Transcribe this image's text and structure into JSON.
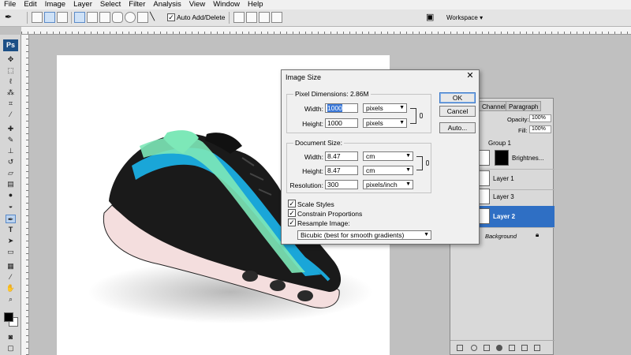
{
  "menu": [
    "File",
    "Edit",
    "Image",
    "Layer",
    "Select",
    "Filter",
    "Analysis",
    "View",
    "Window",
    "Help"
  ],
  "options_bar": {
    "auto_add_delete_label": "Auto Add/Delete",
    "auto_add_delete_checked": true,
    "workspace_label": "Workspace ▾"
  },
  "toolbox": {
    "logo": "Ps",
    "foreground_color": "#000000",
    "background_color": "#ffffff"
  },
  "dialog": {
    "title": "Image Size",
    "close_glyph": "✕",
    "pixel_dimensions": {
      "title": "Pixel Dimensions:",
      "size": "2.86M",
      "width_label": "Width:",
      "width_value": "1000",
      "width_unit": "pixels",
      "height_label": "Height:",
      "height_value": "1000",
      "height_unit": "pixels"
    },
    "document_size": {
      "title": "Document Size:",
      "width_label": "Width:",
      "width_value": "8.47",
      "width_unit": "cm",
      "height_label": "Height:",
      "height_value": "8.47",
      "height_unit": "cm",
      "resolution_label": "Resolution:",
      "resolution_value": "300",
      "resolution_unit": "pixels/inch"
    },
    "options": {
      "scale_styles": "Scale Styles",
      "scale_styles_checked": true,
      "constrain_proportions": "Constrain Proportions",
      "constrain_proportions_checked": true,
      "resample_image": "Resample Image:",
      "resample_image_checked": true,
      "resample_method": "Bicubic (best for smooth gradients)"
    },
    "buttons": {
      "ok": "OK",
      "cancel": "Cancel",
      "auto": "Auto..."
    }
  },
  "layers_panel": {
    "tabs": [
      "Channels",
      "Paragraph"
    ],
    "opacity_label": "Opacity:",
    "opacity_value": "100%",
    "fill_label": "Fill:",
    "fill_value": "100%",
    "group_name": "Group 1",
    "layers": [
      {
        "name": "Brightnes...",
        "active": false
      },
      {
        "name": "Layer 1",
        "active": false
      },
      {
        "name": "Layer 3",
        "active": false
      },
      {
        "name": "Layer 2",
        "active": true
      }
    ],
    "background_layer": "Background",
    "active_color": "#2f6fc4"
  }
}
